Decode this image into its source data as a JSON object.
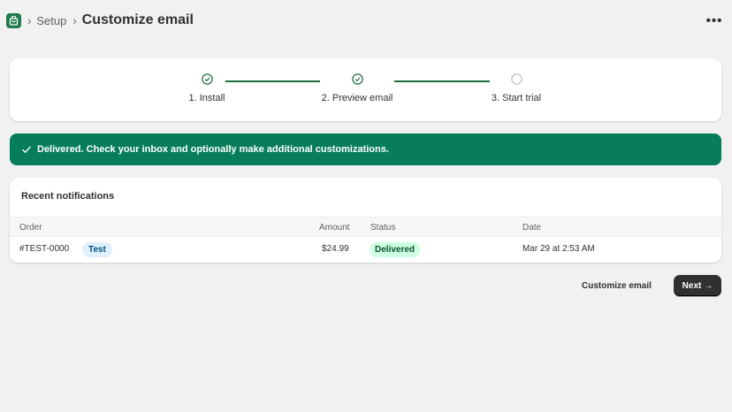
{
  "header": {
    "breadcrumb_sep": "›",
    "breadcrumb_parent": "Setup",
    "title": "Customize email",
    "more_icon": "•••"
  },
  "stepper": {
    "steps": [
      {
        "label": "1. Install",
        "state": "complete"
      },
      {
        "label": "2. Preview email",
        "state": "complete"
      },
      {
        "label": "3. Start trial",
        "state": "incomplete"
      }
    ]
  },
  "banner": {
    "text": "Delivered. Check your inbox and optionally make additional customizations."
  },
  "notifications": {
    "title": "Recent notifications",
    "columns": {
      "order": "Order",
      "amount": "Amount",
      "status": "Status",
      "date": "Date"
    },
    "rows": [
      {
        "order": "#TEST-0000",
        "tag": "Test",
        "amount": "$24.99",
        "status": "Delivered",
        "date": "Mar 29 at 2:53 AM"
      }
    ]
  },
  "actions": {
    "customize_label": "Customize email",
    "next_label": "Next",
    "next_arrow": "→"
  },
  "colors": {
    "accent": "#1f7a4d",
    "banner_bg": "#087d5b",
    "primary_button": "#303030"
  }
}
